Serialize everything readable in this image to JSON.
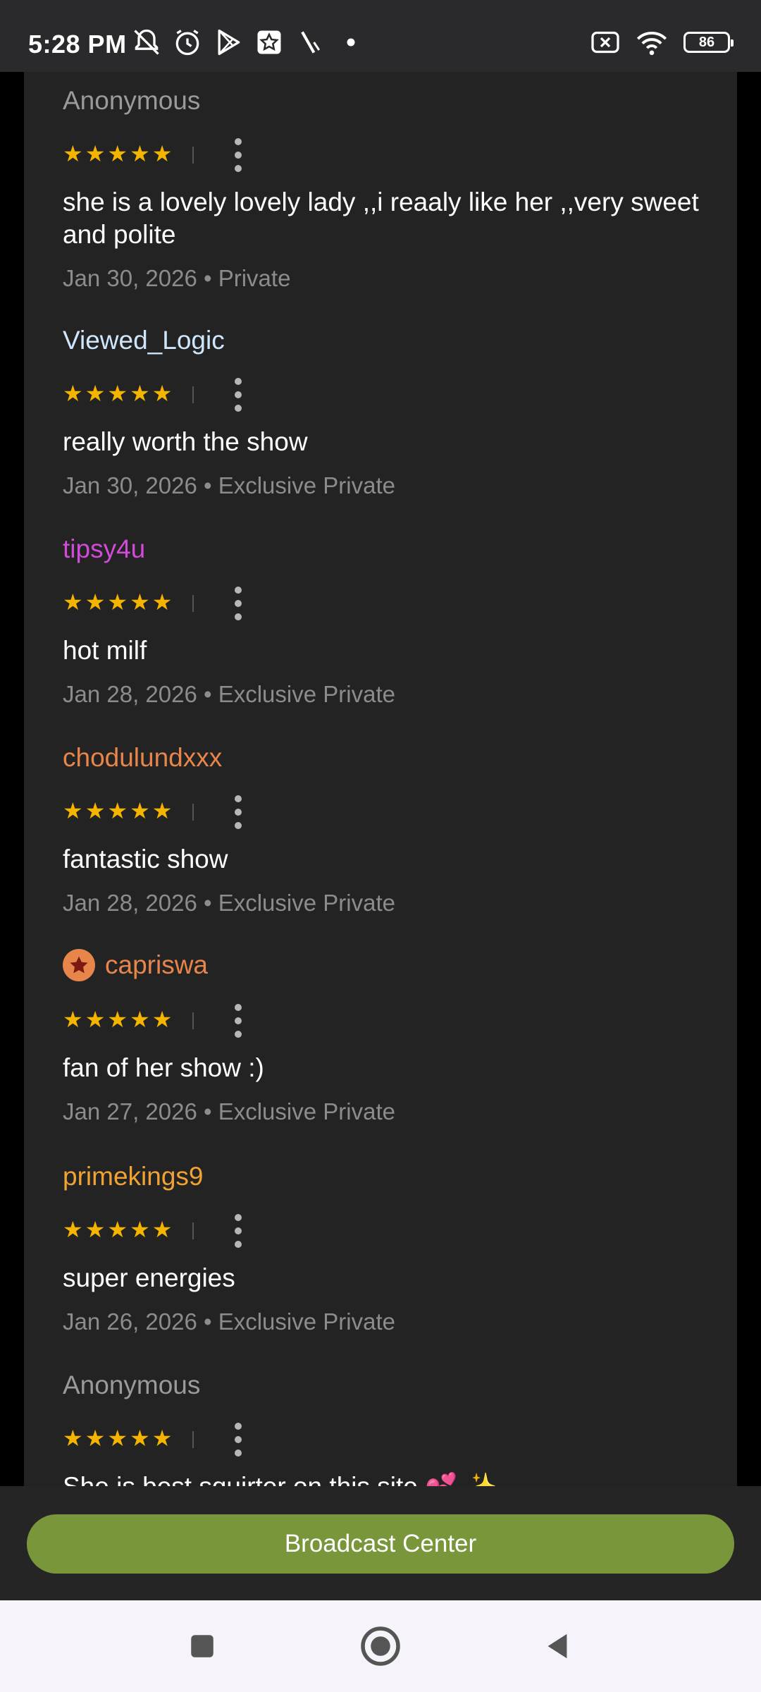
{
  "status_bar": {
    "time": "5:28 PM",
    "icons_left": [
      "bell-off-icon",
      "alarm-icon",
      "play-store-icon",
      "star-app-icon",
      "slash-app-icon",
      "dot-icon"
    ],
    "icons_right": [
      "sim-blocked-icon",
      "wifi-icon",
      "battery-icon"
    ],
    "battery_level": "86"
  },
  "colors": {
    "star": "#f5b400",
    "name_anonymous": "#9a9a9a",
    "name_viewed_logic": "#cfe6fb",
    "name_tipsy": "#d24bd8",
    "name_chodulund": "#e8854a",
    "name_capriswa": "#e8854a",
    "name_primekings": "#f0a332",
    "broadcast_button": "#7a963b"
  },
  "reviews": [
    {
      "name": "Anonymous",
      "rating": 5,
      "text": "she is a lovely lovely lady ,,i reaaly like her ,,very sweet and polite",
      "meta": "Jan 30, 2026 • Private"
    },
    {
      "name": "Viewed_Logic",
      "rating": 5,
      "text": "really worth the show",
      "meta": "Jan 30, 2026 • Exclusive Private"
    },
    {
      "name": "tipsy4u",
      "rating": 5,
      "text": "hot milf",
      "meta": "Jan 28, 2026 • Exclusive Private"
    },
    {
      "name": "chodulundxxx",
      "rating": 5,
      "text": "fantastic show",
      "meta": "Jan 28, 2026 • Exclusive Private"
    },
    {
      "name": "capriswa",
      "rating": 5,
      "text": "fan of her show :)",
      "meta": "Jan 27, 2026 • Exclusive Private"
    },
    {
      "name": "primekings9",
      "rating": 5,
      "text": "super energies",
      "meta": "Jan 26, 2026 • Exclusive Private"
    },
    {
      "name": "Anonymous",
      "rating": 5,
      "text": "She is best squirter on this site 💕 ✨",
      "meta": ""
    }
  ],
  "bottom": {
    "broadcast_label": "Broadcast Center"
  },
  "nav": {
    "items": [
      "recents-square-icon",
      "home-circle-icon",
      "back-triangle-icon"
    ]
  }
}
